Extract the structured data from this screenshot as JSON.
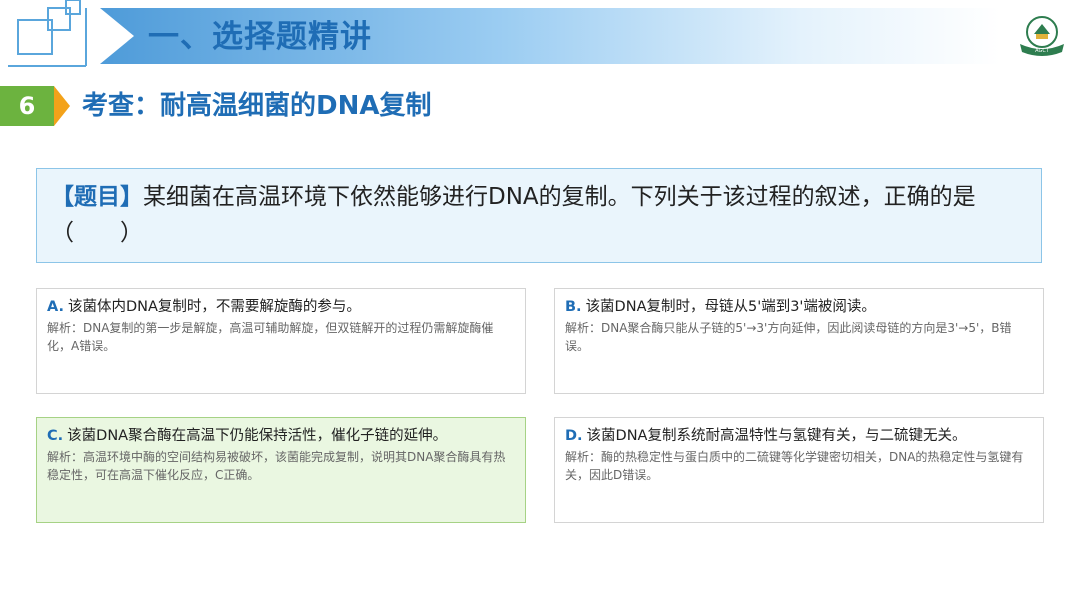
{
  "banner": {
    "title": "一、选择题精讲"
  },
  "logo": {
    "text": "AGCT"
  },
  "section": {
    "number": "6",
    "title": "考查：耐高温细菌的DNA复制"
  },
  "question": {
    "tag": "【题目】",
    "text": "某细菌在高温环境下依然能够进行DNA的复制。下列关于该过程的叙述，正确的是（　　）"
  },
  "options": [
    {
      "letter": "A.",
      "statement": "该菌体内DNA复制时，不需要解旋酶的参与。",
      "explanation": "解析：DNA复制的第一步是解旋，高温可辅助解旋，但双链解开的过程仍需解旋酶催化，A错误。"
    },
    {
      "letter": "B.",
      "statement": "该菌DNA复制时，母链从5'端到3'端被阅读。",
      "explanation": "解析：DNA聚合酶只能从子链的5'→3'方向延伸，因此阅读母链的方向是3'→5'，B错误。"
    },
    {
      "letter": "C.",
      "statement": "该菌DNA聚合酶在高温下仍能保持活性，催化子链的延伸。",
      "explanation": "解析：高温环境中酶的空间结构易被破坏，该菌能完成复制，说明其DNA聚合酶具有热稳定性，可在高温下催化反应，C正确。"
    },
    {
      "letter": "D.",
      "statement": "该菌DNA复制系统耐高温特性与氢键有关，与二硫键无关。",
      "explanation": "解析：酶的热稳定性与蛋白质中的二硫键等化学键密切相关，DNA的热稳定性与氢键有关，因此D错误。"
    }
  ],
  "colors": {
    "accent_blue": "#1f6db5",
    "number_green": "#6cb33f",
    "arrow_orange": "#f3a21a",
    "correct_bg": "#eaf7e1"
  }
}
